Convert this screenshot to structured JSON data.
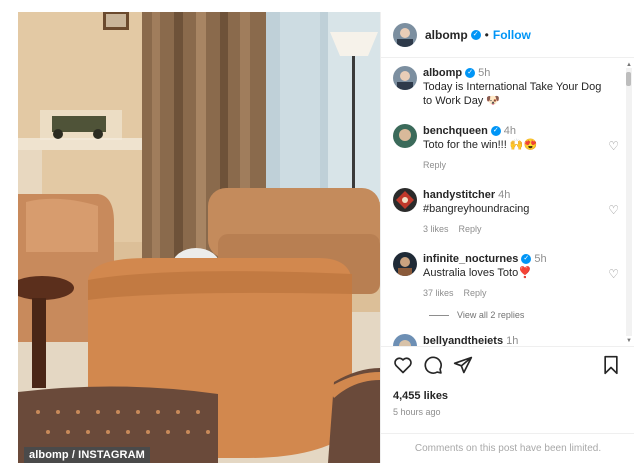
{
  "credit": "albomp / INSTAGRAM",
  "post": {
    "username": "albomp",
    "follow_label": "Follow",
    "separator": "•",
    "likes": "4,455 likes",
    "time_ago": "5 hours ago",
    "comments_limited": "Comments on this post have been limited."
  },
  "caption": {
    "username": "albomp",
    "time": "5h",
    "text": "Today is International Take Your Dog to Work Day 🐶"
  },
  "comments": [
    {
      "username": "benchqueen",
      "time": "4h",
      "text": "Toto for the win!!! 🙌😍",
      "likes": "",
      "reply": "Reply"
    },
    {
      "username": "handystitcher",
      "time": "4h",
      "text": "#bangreyhoundracing",
      "likes": "3 likes",
      "reply": "Reply"
    },
    {
      "username": "infinite_nocturnes",
      "time": "5h",
      "text": "Australia loves Toto❣️",
      "likes": "37 likes",
      "reply": "Reply",
      "view_replies": "View all 2 replies"
    },
    {
      "username": "bellyandtheiets",
      "time": "1h"
    }
  ],
  "icons": {
    "like": "heart-icon",
    "comment": "comment-icon",
    "share": "share-icon",
    "save": "bookmark-icon",
    "verified": "verified-badge-icon"
  },
  "colors": {
    "link": "#0095f6",
    "hashtag": "#00376b",
    "muted": "#8e8e8e"
  }
}
